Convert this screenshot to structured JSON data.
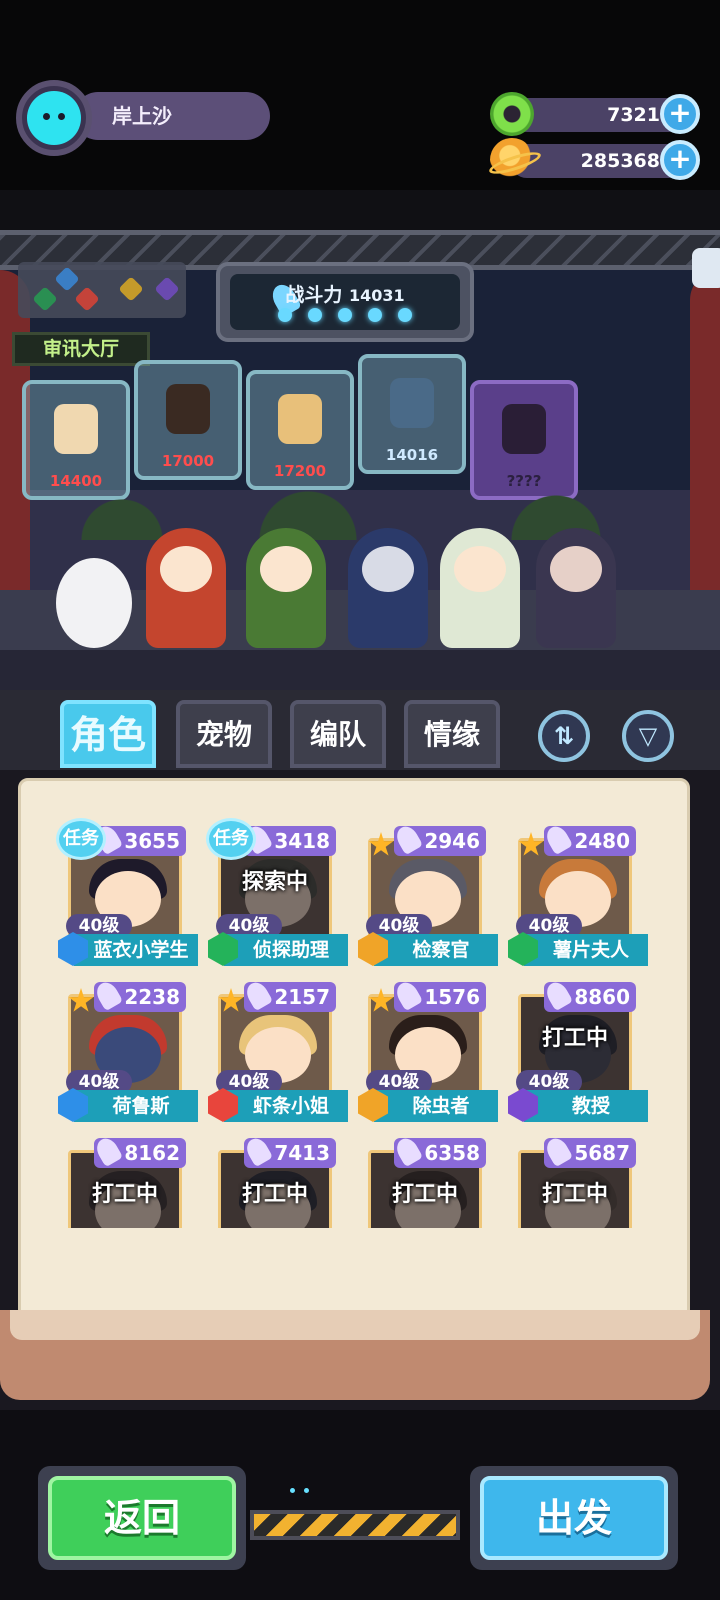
{
  "player": {
    "name": "岸上沙"
  },
  "currencies": [
    {
      "name": "donut",
      "value": "7321"
    },
    {
      "name": "planet-coin",
      "value": "285368"
    }
  ],
  "stage": {
    "room_label": "审讯大厅",
    "power_label": "战斗力",
    "power_value": "14031",
    "frames": [
      "14400",
      "17000",
      "17200",
      "14016",
      "????"
    ]
  },
  "tabs": [
    "角色",
    "宠物",
    "编队",
    "情缘"
  ],
  "cards": [
    {
      "power": "3655",
      "level": "40级",
      "name": "蓝衣小学生",
      "badge": "任务",
      "status": "",
      "class_color": "#2e8fe8"
    },
    {
      "power": "3418",
      "level": "40级",
      "name": "侦探助理",
      "badge": "任务",
      "status": "探索中",
      "class_color": "#24b35a"
    },
    {
      "power": "2946",
      "level": "40级",
      "name": "检察官",
      "badge": "",
      "status": "",
      "class_color": "#f0a428"
    },
    {
      "power": "2480",
      "level": "40级",
      "name": "薯片夫人",
      "badge": "",
      "status": "",
      "class_color": "#24b35a"
    },
    {
      "power": "2238",
      "level": "40级",
      "name": "荷鲁斯",
      "badge": "",
      "status": "",
      "class_color": "#2e8fe8"
    },
    {
      "power": "2157",
      "level": "40级",
      "name": "虾条小姐",
      "badge": "",
      "status": "",
      "class_color": "#e8453c"
    },
    {
      "power": "1576",
      "level": "40级",
      "name": "除虫者",
      "badge": "",
      "status": "",
      "class_color": "#f0a428"
    },
    {
      "power": "8860",
      "level": "40级",
      "name": "教授",
      "badge": "",
      "status": "打工中",
      "class_color": "#7a4ad0"
    },
    {
      "power": "8162",
      "level": "",
      "name": "",
      "badge": "",
      "status": "打工中",
      "class_color": ""
    },
    {
      "power": "7413",
      "level": "",
      "name": "",
      "badge": "",
      "status": "打工中",
      "class_color": ""
    },
    {
      "power": "6358",
      "level": "",
      "name": "",
      "badge": "",
      "status": "打工中",
      "class_color": ""
    },
    {
      "power": "5687",
      "level": "",
      "name": "",
      "badge": "",
      "status": "打工中",
      "class_color": ""
    }
  ],
  "buttons": {
    "back": "返回",
    "go": "出发"
  }
}
